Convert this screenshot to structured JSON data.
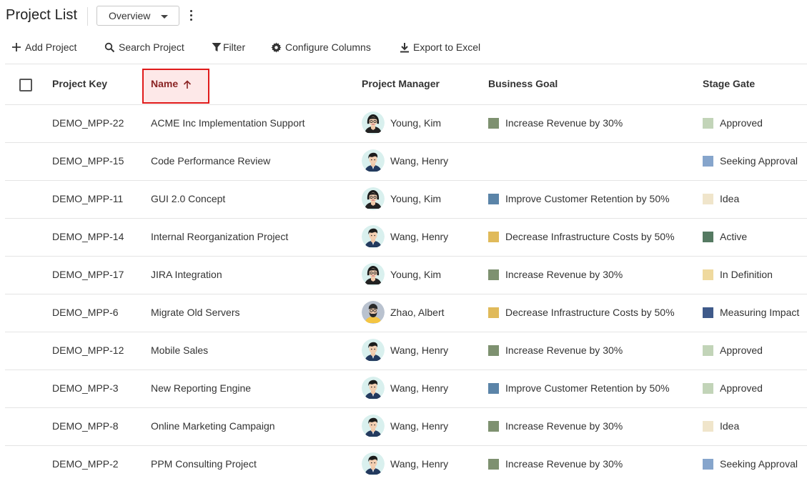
{
  "header": {
    "title": "Project List",
    "view_selector": "Overview"
  },
  "toolbar": {
    "add": "Add Project",
    "search": "Search Project",
    "filter": "Filter",
    "configure": "Configure Columns",
    "export": "Export to Excel"
  },
  "columns": {
    "key": "Project Key",
    "name": "Name",
    "manager": "Project Manager",
    "goal": "Business Goal",
    "gate": "Stage Gate"
  },
  "sort": {
    "column": "Name",
    "direction": "ascending"
  },
  "colors": {
    "goal_revenue": "#7e9170",
    "goal_retention": "#5b84a8",
    "goal_costs": "#e0ba5a",
    "gate_approved": "#c2d4b8",
    "gate_seeking": "#86a5cc",
    "gate_idea": "#f0e5cb",
    "gate_active": "#557a62",
    "gate_definition": "#efd99e",
    "gate_measuring": "#3f5a8a",
    "highlight_border": "#e01a1a"
  },
  "rows": [
    {
      "key": "DEMO_MPP-22",
      "name": "ACME Inc Implementation Support",
      "manager": "Young, Kim",
      "avatar": "female-avatar",
      "goal": "Increase Revenue by 30%",
      "goal_color": "#7e9170",
      "gate": "Approved",
      "gate_color": "#c2d4b8"
    },
    {
      "key": "DEMO_MPP-15",
      "name": "Code Performance Review",
      "manager": "Wang, Henry",
      "avatar": "male-avatar",
      "goal": "",
      "goal_color": "",
      "gate": "Seeking Approval",
      "gate_color": "#86a5cc"
    },
    {
      "key": "DEMO_MPP-11",
      "name": "GUI 2.0 Concept",
      "manager": "Young, Kim",
      "avatar": "female-avatar",
      "goal": "Improve Customer Retention by 50%",
      "goal_color": "#5b84a8",
      "gate": "Idea",
      "gate_color": "#f0e5cb"
    },
    {
      "key": "DEMO_MPP-14",
      "name": "Internal Reorganization Project",
      "manager": "Wang, Henry",
      "avatar": "male-avatar",
      "goal": "Decrease Infrastructure Costs by 50%",
      "goal_color": "#e0ba5a",
      "gate": "Active",
      "gate_color": "#557a62"
    },
    {
      "key": "DEMO_MPP-17",
      "name": "JIRA Integration",
      "manager": "Young, Kim",
      "avatar": "female-avatar",
      "goal": "Increase Revenue by 30%",
      "goal_color": "#7e9170",
      "gate": "In Definition",
      "gate_color": "#efd99e"
    },
    {
      "key": "DEMO_MPP-6",
      "name": "Migrate Old Servers",
      "manager": "Zhao, Albert",
      "avatar": "bearded-avatar",
      "goal": "Decrease Infrastructure Costs by 50%",
      "goal_color": "#e0ba5a",
      "gate": "Measuring Impact",
      "gate_color": "#3f5a8a"
    },
    {
      "key": "DEMO_MPP-12",
      "name": "Mobile Sales",
      "manager": "Wang, Henry",
      "avatar": "male-avatar",
      "goal": "Increase Revenue by 30%",
      "goal_color": "#7e9170",
      "gate": "Approved",
      "gate_color": "#c2d4b8"
    },
    {
      "key": "DEMO_MPP-3",
      "name": "New Reporting Engine",
      "manager": "Wang, Henry",
      "avatar": "male-avatar",
      "goal": "Improve Customer Retention by 50%",
      "goal_color": "#5b84a8",
      "gate": "Approved",
      "gate_color": "#c2d4b8"
    },
    {
      "key": "DEMO_MPP-8",
      "name": "Online Marketing Campaign",
      "manager": "Wang, Henry",
      "avatar": "male-avatar",
      "goal": "Increase Revenue by 30%",
      "goal_color": "#7e9170",
      "gate": "Idea",
      "gate_color": "#f0e5cb"
    },
    {
      "key": "DEMO_MPP-2",
      "name": "PPM Consulting Project",
      "manager": "Wang, Henry",
      "avatar": "male-avatar",
      "goal": "Increase Revenue by 30%",
      "goal_color": "#7e9170",
      "gate": "Seeking Approval",
      "gate_color": "#86a5cc"
    }
  ]
}
